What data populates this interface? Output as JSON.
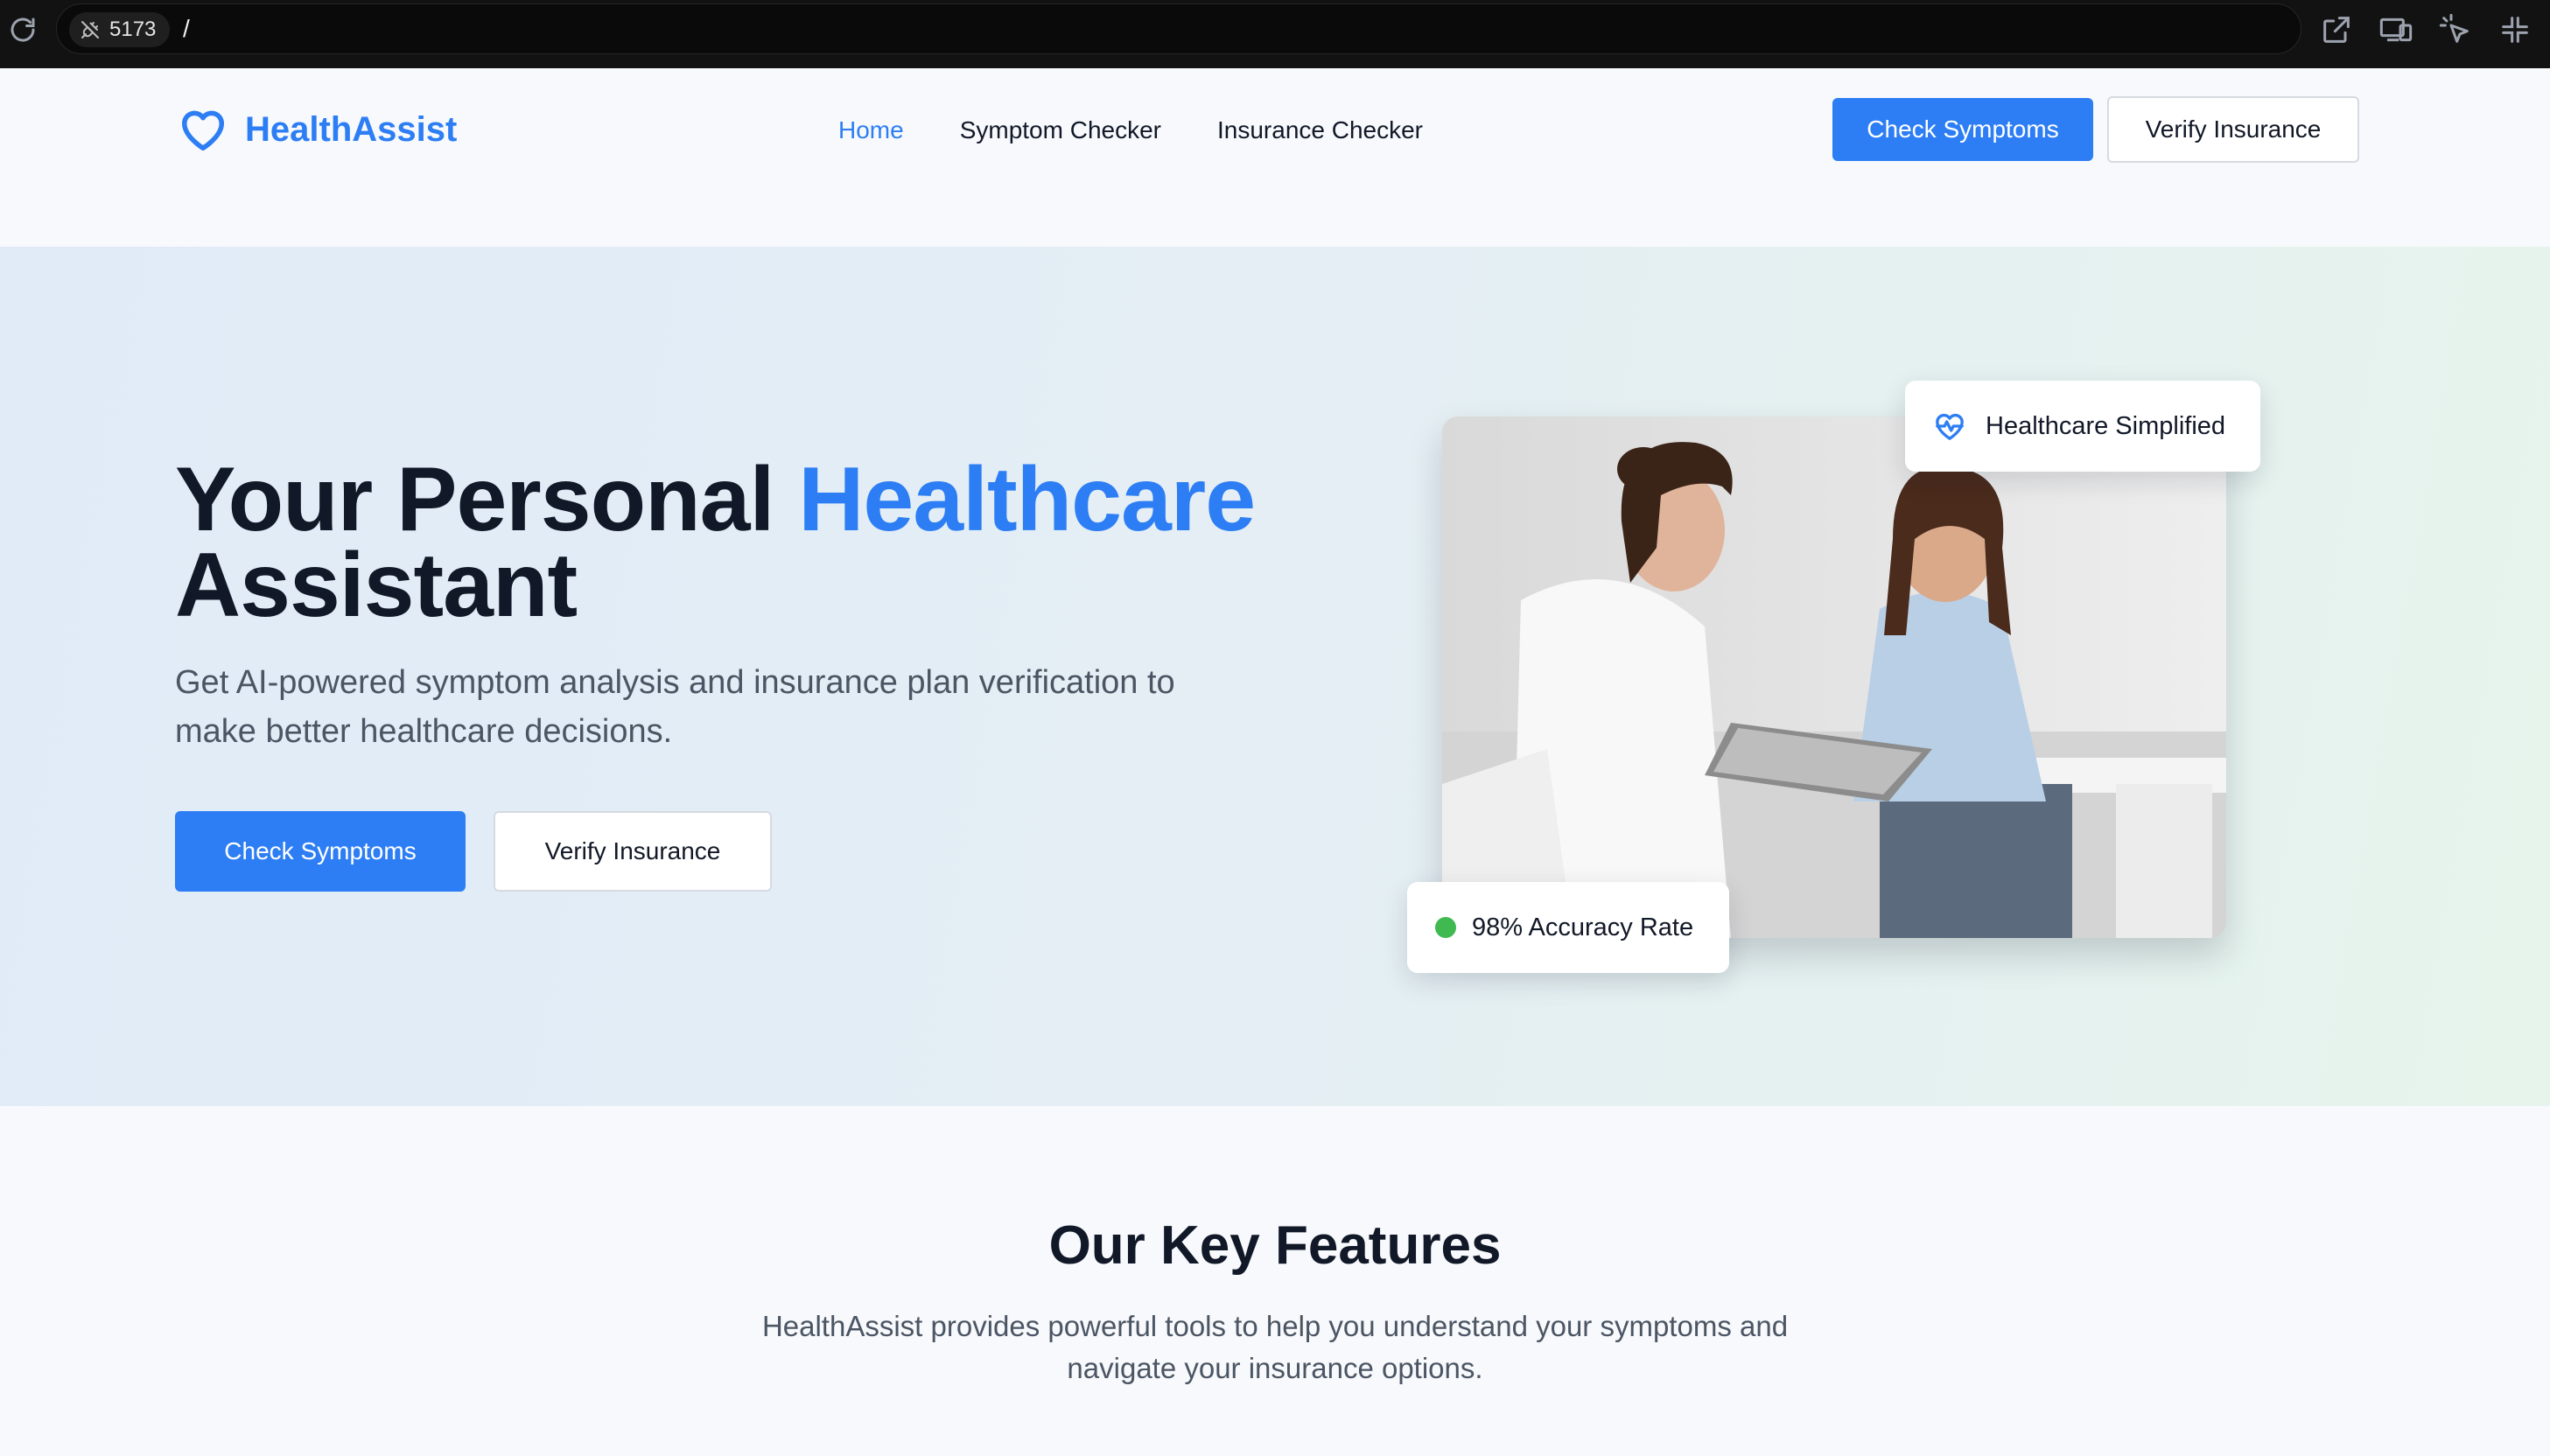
{
  "browser": {
    "port": "5173",
    "path": "/"
  },
  "nav": {
    "brand": "HealthAssist",
    "links": [
      {
        "label": "Home",
        "active": true
      },
      {
        "label": "Symptom Checker",
        "active": false
      },
      {
        "label": "Insurance Checker",
        "active": false
      }
    ],
    "primary_cta": "Check Symptoms",
    "secondary_cta": "Verify Insurance"
  },
  "hero": {
    "title_part1": "Your Personal ",
    "title_accent": "Healthcare",
    "title_part2": "Assistant",
    "subtitle": "Get AI-powered symptom analysis and insurance plan verification to make better healthcare decisions.",
    "primary_cta": "Check Symptoms",
    "secondary_cta": "Verify Insurance",
    "badge_top": "Healthcare Simplified",
    "badge_bottom": "98% Accuracy Rate"
  },
  "features": {
    "title": "Our Key Features",
    "subtitle": "HealthAssist provides powerful tools to help you understand your symptoms and navigate your insurance options."
  },
  "colors": {
    "brand": "#2d7ef4",
    "status_green": "#3fb950",
    "text_dark": "#111827",
    "text_muted": "#4b5563"
  }
}
